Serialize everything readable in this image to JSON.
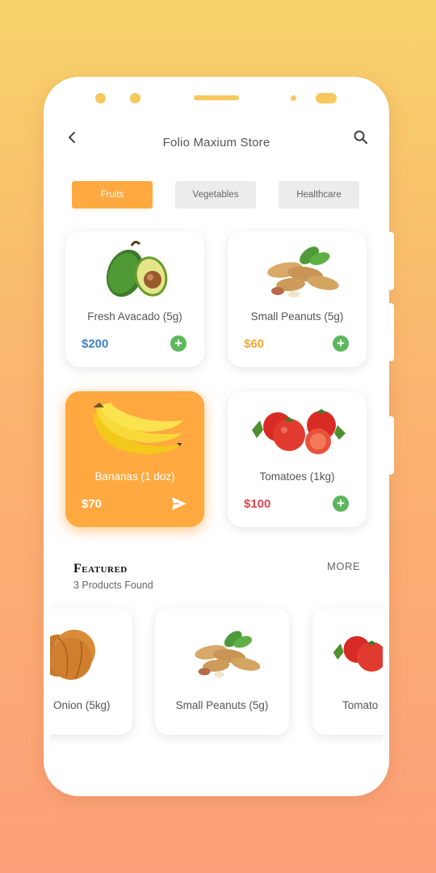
{
  "header": {
    "title": "Folio Maxium Store"
  },
  "tabs": [
    {
      "label": "Fruits"
    },
    {
      "label": "Vegetables"
    },
    {
      "label": "Healthcare"
    }
  ],
  "products": [
    {
      "name": "Fresh Avacado (5g)",
      "price": "$200",
      "price_color": "#3e82c8",
      "icon": "avocado-image"
    },
    {
      "name": "Small Peanuts (5g)",
      "price": "$60",
      "price_color": "#f0a830",
      "icon": "peanuts-image"
    },
    {
      "name": "Bananas (1 doz)",
      "price": "$70",
      "price_color": "#ffffff",
      "icon": "bananas-image"
    },
    {
      "name": "Tomatoes (1kg)",
      "price": "$100",
      "price_color": "#e0454b",
      "icon": "tomatoes-image"
    }
  ],
  "featured": {
    "title": "Featured",
    "subtitle": "3 Products Found",
    "more_label": "MORE",
    "items": [
      {
        "name": "Onion (5kg)",
        "icon": "onion-image"
      },
      {
        "name": "Small Peanuts (5g)",
        "icon": "peanuts-image"
      },
      {
        "name": "Tomato",
        "icon": "tomatoes-image"
      }
    ]
  },
  "colors": {
    "accent": "#ffa940",
    "add_button": "#5cb85c",
    "background_top": "#f7d26a",
    "background_bottom": "#fd9f7a"
  }
}
